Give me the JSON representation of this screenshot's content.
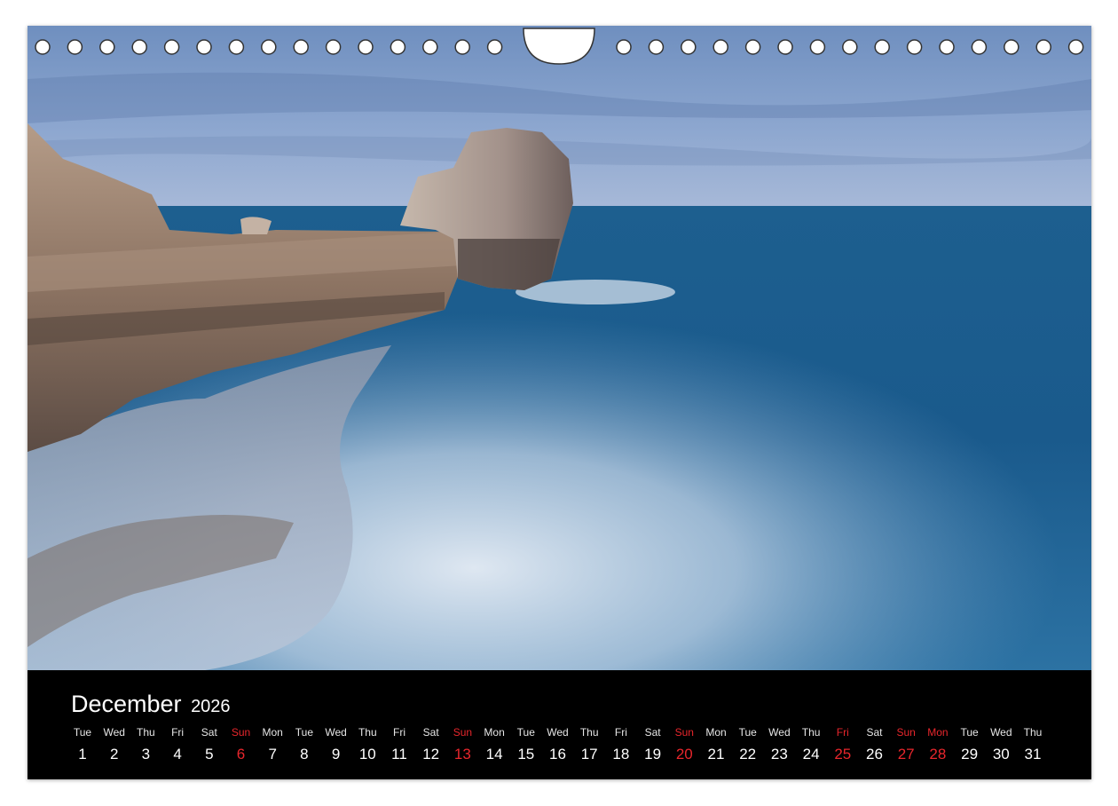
{
  "calendar": {
    "month": "December",
    "year": "2026",
    "colors": {
      "text": "#ffffff",
      "holiday": "#e8262c",
      "band": "#000000"
    },
    "days": [
      {
        "name": "Tue",
        "num": "1",
        "red": false
      },
      {
        "name": "Wed",
        "num": "2",
        "red": false
      },
      {
        "name": "Thu",
        "num": "3",
        "red": false
      },
      {
        "name": "Fri",
        "num": "4",
        "red": false
      },
      {
        "name": "Sat",
        "num": "5",
        "red": false
      },
      {
        "name": "Sun",
        "num": "6",
        "red": true
      },
      {
        "name": "Mon",
        "num": "7",
        "red": false
      },
      {
        "name": "Tue",
        "num": "8",
        "red": false
      },
      {
        "name": "Wed",
        "num": "9",
        "red": false
      },
      {
        "name": "Thu",
        "num": "10",
        "red": false
      },
      {
        "name": "Fri",
        "num": "11",
        "red": false
      },
      {
        "name": "Sat",
        "num": "12",
        "red": false
      },
      {
        "name": "Sun",
        "num": "13",
        "red": true
      },
      {
        "name": "Mon",
        "num": "14",
        "red": false
      },
      {
        "name": "Tue",
        "num": "15",
        "red": false
      },
      {
        "name": "Wed",
        "num": "16",
        "red": false
      },
      {
        "name": "Thu",
        "num": "17",
        "red": false
      },
      {
        "name": "Fri",
        "num": "18",
        "red": false
      },
      {
        "name": "Sat",
        "num": "19",
        "red": false
      },
      {
        "name": "Sun",
        "num": "20",
        "red": true
      },
      {
        "name": "Mon",
        "num": "21",
        "red": false
      },
      {
        "name": "Tue",
        "num": "22",
        "red": false
      },
      {
        "name": "Wed",
        "num": "23",
        "red": false
      },
      {
        "name": "Thu",
        "num": "24",
        "red": false
      },
      {
        "name": "Fri",
        "num": "25",
        "red": true
      },
      {
        "name": "Sat",
        "num": "26",
        "red": false
      },
      {
        "name": "Sun",
        "num": "27",
        "red": true
      },
      {
        "name": "Mon",
        "num": "28",
        "red": true
      },
      {
        "name": "Tue",
        "num": "29",
        "red": false
      },
      {
        "name": "Wed",
        "num": "30",
        "red": false
      },
      {
        "name": "Thu",
        "num": "31",
        "red": false
      }
    ]
  }
}
